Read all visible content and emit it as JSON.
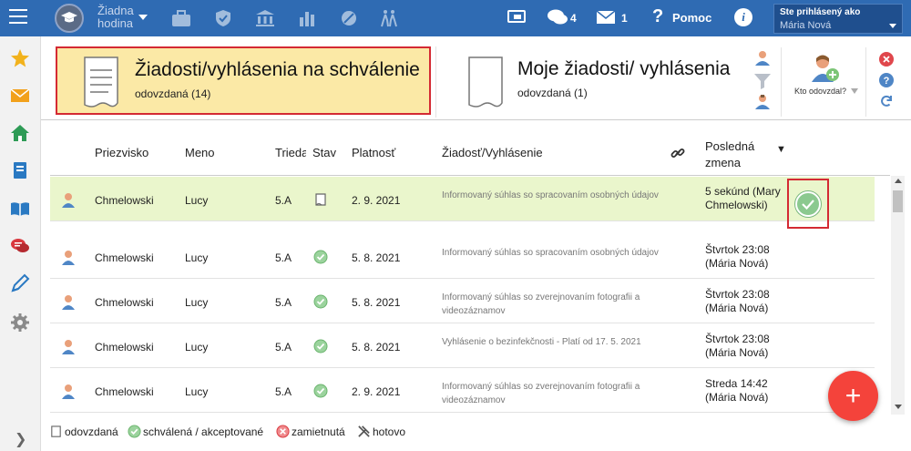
{
  "topbar": {
    "hour_label": "Žiadna hodina",
    "chat_count": "4",
    "mail_count": "1",
    "help_label": "Pomoc",
    "user_caption": "Ste prihlásený ako",
    "user_name": "Mária Nová"
  },
  "cards": {
    "pending_title": "Žiadosti/vyhlásenia na schválenie",
    "pending_sub": "odovzdaná (14)",
    "mine_title": "Moje žiadosti/ vyhlásenia",
    "mine_sub": "odovzdaná (1)"
  },
  "tools": {
    "who_label": "Kto odovzdal?"
  },
  "table": {
    "headers": {
      "surname": "Priezvisko",
      "name": "Meno",
      "class": "Trieda",
      "status": "Stav",
      "validity": "Platnosť",
      "request": "Žiadosť/Vyhlásenie",
      "last_change": "Posledná zmena",
      "sort": "▼"
    },
    "rows": [
      {
        "surname": "Chmelowski",
        "name": "Lucy",
        "class": "5.A",
        "status": "odovzdaná",
        "validity": "2. 9. 2021",
        "request": "Informovaný súhlas so spracovaním osobných údajov",
        "last_change": "5 sekúnd (Mary Chmelowski)"
      },
      {
        "surname": "Chmelowski",
        "name": "Lucy",
        "class": "5.A",
        "status": "schválená",
        "validity": "5. 8. 2021",
        "request": "Informovaný súhlas so spracovaním osobných údajov",
        "last_change": "Štvrtok 23:08 (Mária Nová)"
      },
      {
        "surname": "Chmelowski",
        "name": "Lucy",
        "class": "5.A",
        "status": "schválená",
        "validity": "5. 8. 2021",
        "request": "Informovaný súhlas so zverejnovaním fotografii a videozáznamov",
        "last_change": "Štvrtok 23:08 (Mária Nová)"
      },
      {
        "surname": "Chmelowski",
        "name": "Lucy",
        "class": "5.A",
        "status": "schválená",
        "validity": "5. 8. 2021",
        "request": "Vyhlásenie o bezinfekčnosti - Platí od 17. 5. 2021",
        "last_change": "Štvrtok 23:08 (Mária Nová)"
      },
      {
        "surname": "Chmelowski",
        "name": "Lucy",
        "class": "5.A",
        "status": "schválená",
        "validity": "2. 9. 2021",
        "request": "Informovaný súhlas so zverejnovaním fotografii a videozáznamov",
        "last_change": "Streda 14:42 (Mária Nová)"
      }
    ]
  },
  "fab_label": "+",
  "legend": {
    "submitted": "odovzdaná",
    "approved": "schválená / akceptované",
    "rejected": "zamietnutá",
    "done": "hotovo"
  },
  "colors": {
    "topbar": "#2f6bb3",
    "highlight_card": "#fbe9a6",
    "highlight_border": "#d42a33",
    "active_row": "#eaf6cc",
    "approved_green": "#8bc98f",
    "fab": "#f4433b"
  }
}
